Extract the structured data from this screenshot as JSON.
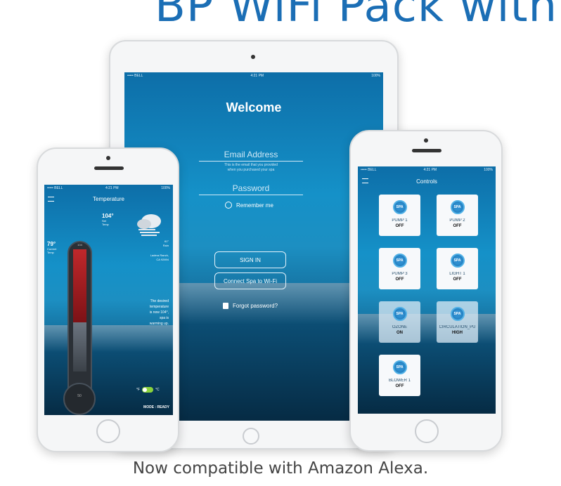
{
  "header": {
    "title": "BP WiFi Pack with Sp"
  },
  "caption": "Now compatible with Amazon Alexa.",
  "tablet": {
    "status": {
      "carrier": "••••• BELL",
      "time": "4:21 PM",
      "battery": "100%"
    },
    "title": "Welcome",
    "email_placeholder": "Email Address",
    "email_hint_1": "This is the email that you provided",
    "email_hint_2": "when you purchased your spa",
    "password_placeholder": "Password",
    "remember_me": "Remember me",
    "sign_in": "SIGN IN",
    "connect": "Connect Spa to Wi-Fi",
    "forgot": "Forgot password?"
  },
  "left_phone": {
    "status": {
      "carrier": "••••• BELL",
      "time": "4:21 PM",
      "battery": "100%"
    },
    "title": "Temperature",
    "set_temp": "104°",
    "set_label_1": "Set",
    "set_label_2": "Temp",
    "current_temp": "79°",
    "current_label_1": "Current",
    "current_label_2": "Temp",
    "weather_temp": "61°",
    "weather_label": "Rain",
    "location_1": "Ladera Ranch,",
    "location_2": "CA 92694",
    "top_tick": "104",
    "bottom_tick": "50",
    "desired_text_1": "The desired",
    "desired_text_2": "temperature",
    "desired_text_3": "is now 104°,",
    "desired_text_4": "spa is",
    "desired_text_5": "warming up.",
    "mode": "MODE : READY"
  },
  "right_phone": {
    "status": {
      "carrier": "••••• BELL",
      "time": "4:21 PM",
      "battery": "100%"
    },
    "title": "Controls",
    "controls": [
      {
        "name": "PUMP 1",
        "state": "OFF"
      },
      {
        "name": "PUMP 2",
        "state": "OFF"
      },
      {
        "name": "PUMP 3",
        "state": "OFF"
      },
      {
        "name": "LIGHT 1",
        "state": "OFF"
      },
      {
        "name": "OZONE",
        "state": "ON"
      },
      {
        "name": "CIRCULATION_PU",
        "state": "HIGH"
      },
      {
        "name": "BLOWER 1",
        "state": "OFF"
      }
    ],
    "icon_label": "SPA"
  },
  "colors": {
    "brand": "#1b6eb5",
    "screen": "#1591c8",
    "deep_water": "#08304d"
  }
}
